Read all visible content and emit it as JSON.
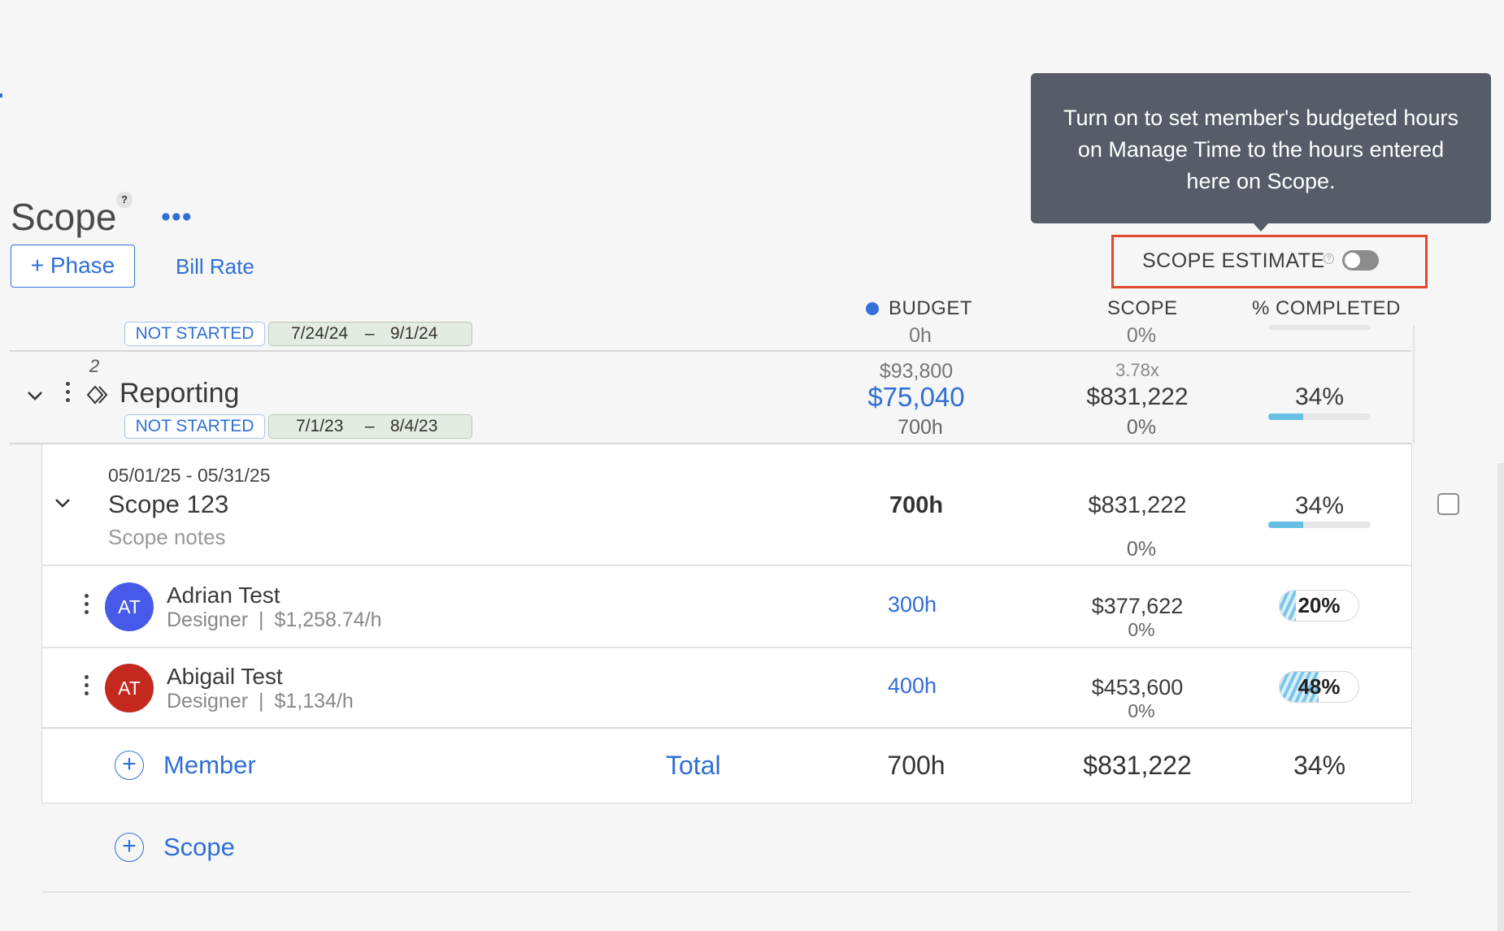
{
  "header": {
    "title": "Scope",
    "help": "?",
    "more": "•••",
    "phase_button": "+ Phase",
    "bill_rate": "Bill Rate"
  },
  "tooltip": {
    "text": "Turn on to set member's budgeted hours on Manage Time to the hours entered here on Scope."
  },
  "scope_estimate": {
    "label": "SCOPE ESTIMATE",
    "help": "?",
    "enabled": false
  },
  "columns": {
    "budget": "BUDGET",
    "scope": "SCOPE",
    "completed": "% COMPLETED"
  },
  "prev_phase": {
    "status": "NOT STARTED",
    "start": "7/24/24",
    "dash": "–",
    "end": "9/1/24",
    "budget": "0h",
    "scope": "0%"
  },
  "phase": {
    "number": "2",
    "name": "Reporting",
    "status": "NOT STARTED",
    "start": "7/1/23",
    "dash": "–",
    "end": "8/4/23",
    "budget_top": "$93,800",
    "budget_amount": "$75,040",
    "budget_hours": "700h",
    "scope_multiplier": "3.78x",
    "scope_amount": "$831,222",
    "scope_pct": "0%",
    "completed": "34%",
    "completed_value": 0.34
  },
  "scope_item": {
    "dates": "05/01/25 - 05/31/25",
    "name": "Scope 123",
    "notes": "Scope notes",
    "hours": "700h",
    "amount": "$831,222",
    "pct": "0%",
    "completed": "34%",
    "completed_value": 0.34
  },
  "members": [
    {
      "initials": "AT",
      "name": "Adrian Test",
      "role": "Designer",
      "sep": "|",
      "rate": "$1,258.74/h",
      "hours": "300h",
      "amount": "$377,622",
      "pct": "0%",
      "completed": "20%",
      "completed_value": 0.2,
      "color": "#4759e8"
    },
    {
      "initials": "AT",
      "name": "Abigail Test",
      "role": "Designer",
      "sep": "|",
      "rate": "$1,134/h",
      "hours": "400h",
      "amount": "$453,600",
      "pct": "0%",
      "completed": "48%",
      "completed_value": 0.48,
      "color": "#c4291f"
    }
  ],
  "totals": {
    "add_member": "Member",
    "label": "Total",
    "hours": "700h",
    "amount": "$831,222",
    "completed": "34%"
  },
  "add_scope": {
    "label": "Scope",
    "plus": "+"
  }
}
